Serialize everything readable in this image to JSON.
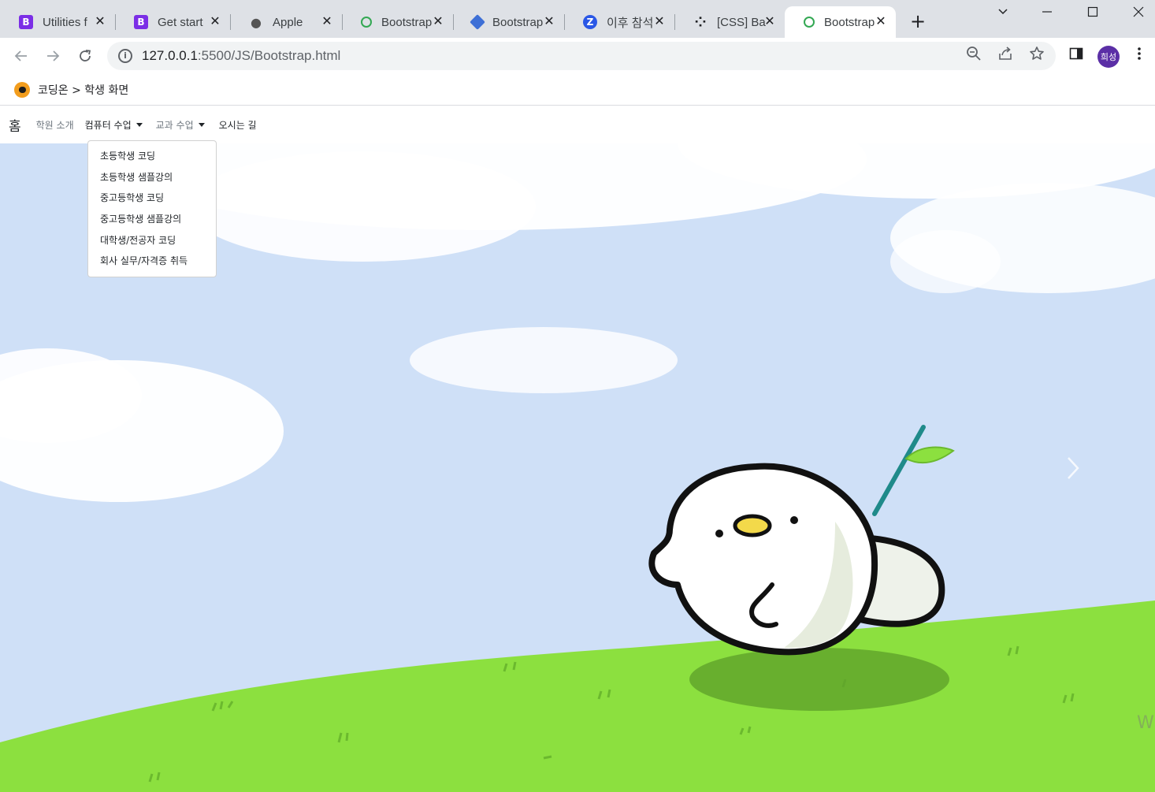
{
  "browser": {
    "tabs": [
      {
        "title": "Utilities f",
        "favicon_letter": "B",
        "favicon_color": "#7952b3",
        "active": false
      },
      {
        "title": "Get start",
        "favicon_letter": "B",
        "favicon_color": "#7952b3",
        "active": false
      },
      {
        "title": "Apple",
        "favicon_letter": "",
        "favicon_color": "#555555",
        "active": false
      },
      {
        "title": "Bootstrap",
        "favicon_letter": "⌕",
        "favicon_color": "#33a853",
        "active": false
      },
      {
        "title": "Bootstrap",
        "favicon_letter": "◆",
        "favicon_color": "#3d6fd6",
        "active": false
      },
      {
        "title": "이후 참석",
        "favicon_letter": "Z",
        "favicon_color": "#2a57e6",
        "active": false
      },
      {
        "title": "[CSS] Ba",
        "favicon_letter": "⁘",
        "favicon_color": "#202124",
        "active": false
      },
      {
        "title": "Bootstrap",
        "favicon_letter": "⌕",
        "favicon_color": "#33a853",
        "active": true
      }
    ],
    "new_tab_symbol": "+",
    "address": {
      "host": "127.0.0.1",
      "path": ":5500/JS/Bootstrap.html"
    },
    "profile_label": "희성"
  },
  "bookmarks": [
    {
      "label": "코딩온 > 학생 화면"
    }
  ],
  "navbar": {
    "brand": "홈",
    "links": [
      {
        "label": "학원 소개",
        "dropdown": false
      },
      {
        "label": "컴퓨터 수업",
        "dropdown": true
      },
      {
        "label": "교과 수업",
        "dropdown": true
      },
      {
        "label": "오시는 길",
        "dropdown": false
      }
    ]
  },
  "dropdown": {
    "open_under": "컴퓨터 수업",
    "items": [
      "초등학생 코딩",
      "초등학생 샘플강의",
      "중고등학생 코딩",
      "중고등학생 샘플강의",
      "대학생/전공자 코딩",
      "회사 실무/자격증 취득"
    ]
  },
  "carousel": {
    "next_icon": "chevron-right-icon"
  },
  "watermark": "W",
  "colors": {
    "sky": "#cfe0f7",
    "grass": "#8ce03f",
    "accent": "#7952b3"
  }
}
